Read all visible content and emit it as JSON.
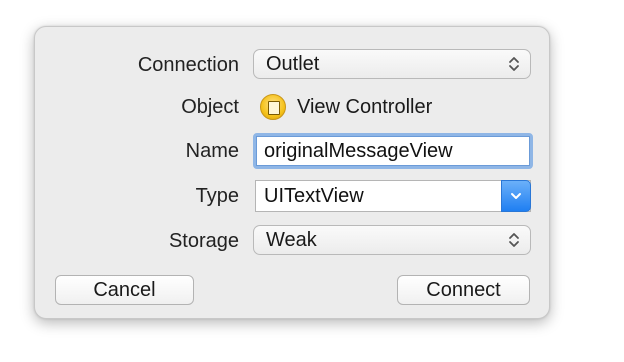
{
  "form": {
    "connection": {
      "label": "Connection",
      "value": "Outlet"
    },
    "object": {
      "label": "Object",
      "value": "View Controller"
    },
    "name": {
      "label": "Name",
      "value": "originalMessageView"
    },
    "type": {
      "label": "Type",
      "value": "UITextView"
    },
    "storage": {
      "label": "Storage",
      "value": "Weak"
    }
  },
  "buttons": {
    "cancel": "Cancel",
    "connect": "Connect"
  },
  "colors": {
    "accent": "#1f7ff2",
    "focus_ring": "#8fb6e6",
    "object_icon": "#f5c21b"
  },
  "icons": {
    "popup_stepper": "up-down-chevron-icon",
    "object": "view-controller-icon",
    "dropdown": "chevron-down-icon"
  }
}
